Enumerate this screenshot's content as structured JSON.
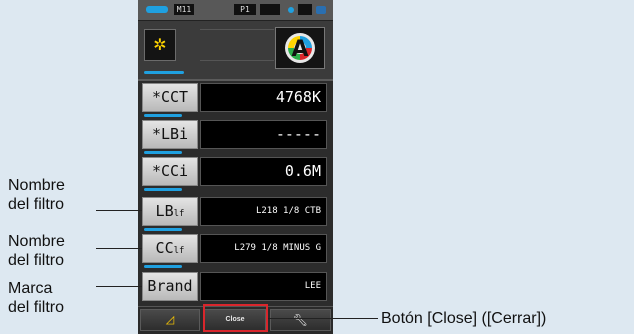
{
  "status_bar": {
    "memory_label": "M11",
    "program_label": "P1"
  },
  "top_panel": {
    "sun_icon": "sun-icon",
    "auto_mode_icon": "auto-mode-A-icon",
    "colors": {
      "sun": "#ffd400",
      "accent": "#1fa0e0"
    }
  },
  "rows": [
    {
      "label": "*CCT",
      "value": "4768K"
    },
    {
      "label": "*LBi",
      "value": "-----"
    },
    {
      "label": "*CCi",
      "value": "0.6M"
    },
    {
      "label_main": "LB",
      "label_sub": "lf",
      "value": "L218 1/8 CTB"
    },
    {
      "label_main": "CC",
      "label_sub": "lf",
      "value": "L279 1/8 MINUS G"
    },
    {
      "label": "Brand",
      "value": "LEE"
    }
  ],
  "bottom_bar": {
    "left_icon": "triangle-icon",
    "close_label": "Close",
    "right_icon": "wrench-icon"
  },
  "callouts": {
    "filter_name_1": [
      "Nombre",
      "del filtro"
    ],
    "filter_name_2": [
      "Nombre",
      "del filtro"
    ],
    "filter_brand": [
      "Marca",
      "del filtro"
    ],
    "close_button": "Botón [Close] ([Cerrar])"
  },
  "highlight_color": "#d9262c"
}
